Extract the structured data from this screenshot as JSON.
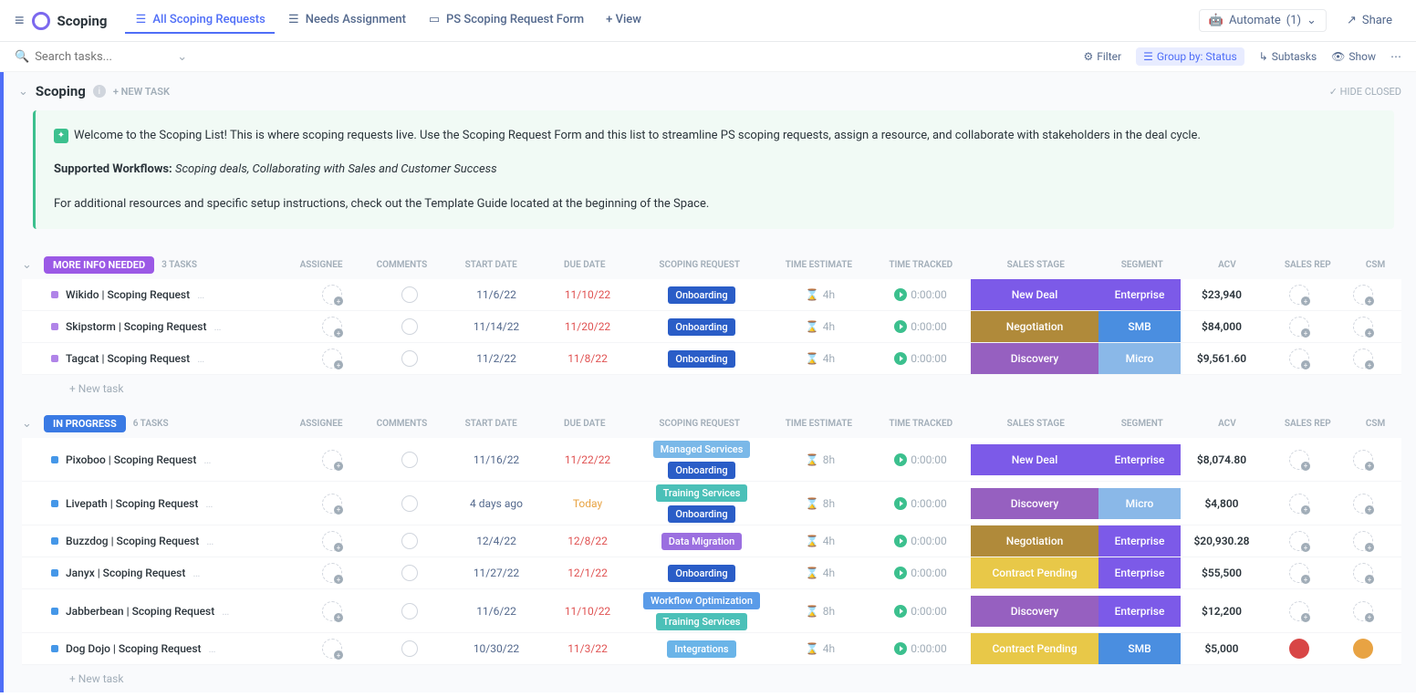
{
  "header": {
    "app_title": "Scoping",
    "tabs": [
      {
        "label": "All Scoping Requests"
      },
      {
        "label": "Needs Assignment"
      },
      {
        "label": "PS Scoping Request Form"
      }
    ],
    "view_button": "+ View",
    "automate": "Automate",
    "automate_count": "(1)",
    "share": "Share"
  },
  "toolbar": {
    "search_placeholder": "Search tasks...",
    "filter": "Filter",
    "group_by": "Group by: Status",
    "subtasks": "Subtasks",
    "show": "Show"
  },
  "section": {
    "title": "Scoping",
    "new_task": "+ NEW TASK",
    "hide_closed": "HIDE CLOSED"
  },
  "intro": {
    "line1": "Welcome to the Scoping List! This is where scoping requests live. Use the Scoping Request Form and this list to streamline PS scoping requests, assign a resource, and collaborate with stakeholders in the deal cycle.",
    "workflows_label": "Supported Workflows:",
    "workflows_text": "Scoping deals, Collaborating with Sales and Customer Success",
    "line3": "For additional resources and specific setup instructions, check out the Template Guide located at the beginning of the Space."
  },
  "columns": {
    "assignee": "ASSIGNEE",
    "comments": "COMMENTS",
    "start_date": "START DATE",
    "due_date": "DUE DATE",
    "scoping_request": "SCOPING REQUEST",
    "time_estimate": "TIME ESTIMATE",
    "time_tracked": "TIME TRACKED",
    "sales_stage": "SALES STAGE",
    "segment": "SEGMENT",
    "acv": "ACV",
    "sales_rep": "SALES REP",
    "csm": "CSM"
  },
  "groups": [
    {
      "status": "MORE INFO NEEDED",
      "status_class": "status-purple",
      "dot_class": "dot-purple",
      "count": "3 TASKS",
      "tasks": [
        {
          "name": "Wikido | Scoping Request",
          "start": "11/6/22",
          "due": "11/10/22",
          "due_red": true,
          "tags": [
            [
              "Onboarding",
              "tag-onboarding"
            ]
          ],
          "estimate": "4h",
          "tracked": "0:00:00",
          "stage": "New Deal",
          "stage_class": "stage-newdeal",
          "segment": "Enterprise",
          "seg_class": "seg-enterprise",
          "acv": "$23,940",
          "rep": "",
          "csm": ""
        },
        {
          "name": "Skipstorm | Scoping Request",
          "start": "11/14/22",
          "due": "11/20/22",
          "due_red": true,
          "tags": [
            [
              "Onboarding",
              "tag-onboarding"
            ]
          ],
          "estimate": "4h",
          "tracked": "0:00:00",
          "stage": "Negotiation",
          "stage_class": "stage-negotiation",
          "segment": "SMB",
          "seg_class": "seg-smb",
          "acv": "$84,000",
          "rep": "",
          "csm": ""
        },
        {
          "name": "Tagcat | Scoping Request",
          "start": "11/2/22",
          "due": "11/8/22",
          "due_red": true,
          "tags": [
            [
              "Onboarding",
              "tag-onboarding"
            ]
          ],
          "estimate": "4h",
          "tracked": "0:00:00",
          "stage": "Discovery",
          "stage_class": "stage-discovery",
          "segment": "Micro",
          "seg_class": "seg-micro",
          "acv": "$9,561.60",
          "rep": "",
          "csm": ""
        }
      ],
      "new_task": "+ New task"
    },
    {
      "status": "IN PROGRESS",
      "status_class": "status-blue",
      "dot_class": "dot-blue",
      "count": "6 TASKS",
      "tasks": [
        {
          "name": "Pixoboo | Scoping Request",
          "start": "11/16/22",
          "due": "11/22/22",
          "due_red": true,
          "tags": [
            [
              "Managed Services",
              "tag-managed"
            ],
            [
              "Onboarding",
              "tag-onboarding"
            ]
          ],
          "estimate": "8h",
          "tracked": "0:00:00",
          "stage": "New Deal",
          "stage_class": "stage-newdeal",
          "segment": "Enterprise",
          "seg_class": "seg-enterprise",
          "acv": "$8,074.80",
          "tall": true,
          "rep": "",
          "csm": ""
        },
        {
          "name": "Livepath | Scoping Request",
          "start": "4 days ago",
          "due": "Today",
          "due_red": false,
          "due_today": true,
          "tags": [
            [
              "Training Services",
              "tag-training"
            ],
            [
              "Onboarding",
              "tag-onboarding"
            ]
          ],
          "estimate": "8h",
          "tracked": "0:00:00",
          "stage": "Discovery",
          "stage_class": "stage-discovery",
          "segment": "Micro",
          "seg_class": "seg-micro",
          "acv": "$4,800",
          "tall": true,
          "rep": "",
          "csm": ""
        },
        {
          "name": "Buzzdog | Scoping Request",
          "start": "12/4/22",
          "due": "12/8/22",
          "due_red": true,
          "tags": [
            [
              "Data Migration",
              "tag-migration"
            ]
          ],
          "estimate": "4h",
          "tracked": "0:00:00",
          "stage": "Negotiation",
          "stage_class": "stage-negotiation",
          "segment": "Enterprise",
          "seg_class": "seg-enterprise",
          "acv": "$20,930.28",
          "rep": "",
          "csm": ""
        },
        {
          "name": "Janyx | Scoping Request",
          "start": "11/27/22",
          "due": "12/1/22",
          "due_red": true,
          "tags": [
            [
              "Onboarding",
              "tag-onboarding"
            ]
          ],
          "estimate": "4h",
          "tracked": "0:00:00",
          "stage": "Contract Pending",
          "stage_class": "stage-contract",
          "segment": "Enterprise",
          "seg_class": "seg-enterprise",
          "acv": "$55,500",
          "rep": "",
          "csm": ""
        },
        {
          "name": "Jabberbean | Scoping Request",
          "start": "11/6/22",
          "due": "11/10/22",
          "due_red": true,
          "tags": [
            [
              "Workflow Optimization",
              "tag-workflow"
            ],
            [
              "Training Services",
              "tag-training"
            ]
          ],
          "estimate": "8h",
          "tracked": "0:00:00",
          "stage": "Discovery",
          "stage_class": "stage-discovery",
          "segment": "Enterprise",
          "seg_class": "seg-enterprise",
          "acv": "$12,200",
          "tall": true,
          "rep": "",
          "csm": ""
        },
        {
          "name": "Dog Dojo | Scoping Request",
          "start": "10/30/22",
          "due": "11/3/22",
          "due_red": true,
          "tags": [
            [
              "Integrations",
              "tag-integrations"
            ]
          ],
          "estimate": "4h",
          "tracked": "0:00:00",
          "stage": "Contract Pending",
          "stage_class": "stage-contract",
          "segment": "SMB",
          "seg_class": "seg-smb",
          "acv": "$5,000",
          "rep": "avatar",
          "csm": "avatar2"
        }
      ],
      "new_task": "+ New task"
    }
  ]
}
